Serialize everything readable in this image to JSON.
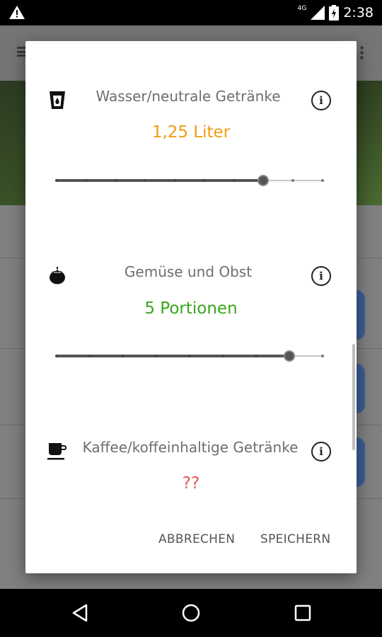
{
  "status_bar": {
    "network": "4G",
    "time": "2:38"
  },
  "dialog": {
    "sections": [
      {
        "title": "Wasser/neutrale Getränke",
        "value": "1,25 Liter",
        "value_color": "#f29a12",
        "icon": "glass-water-icon",
        "slider": {
          "steps": 10,
          "selected_step": 7
        }
      },
      {
        "title": "Gemüse und Obst",
        "value": "5 Portionen",
        "value_color": "#3aa51c",
        "icon": "tomato-icon",
        "slider": {
          "steps": 9,
          "selected_step": 7
        }
      },
      {
        "title": "Kaffee/koffeinhaltige Getränke",
        "value": "??",
        "value_color": "#e05a4f",
        "icon": "coffee-cup-icon"
      }
    ],
    "actions": {
      "cancel": "ABBRECHEN",
      "save": "SPEICHERN"
    }
  },
  "navigation": [
    "back-icon",
    "home-icon",
    "recents-icon"
  ]
}
